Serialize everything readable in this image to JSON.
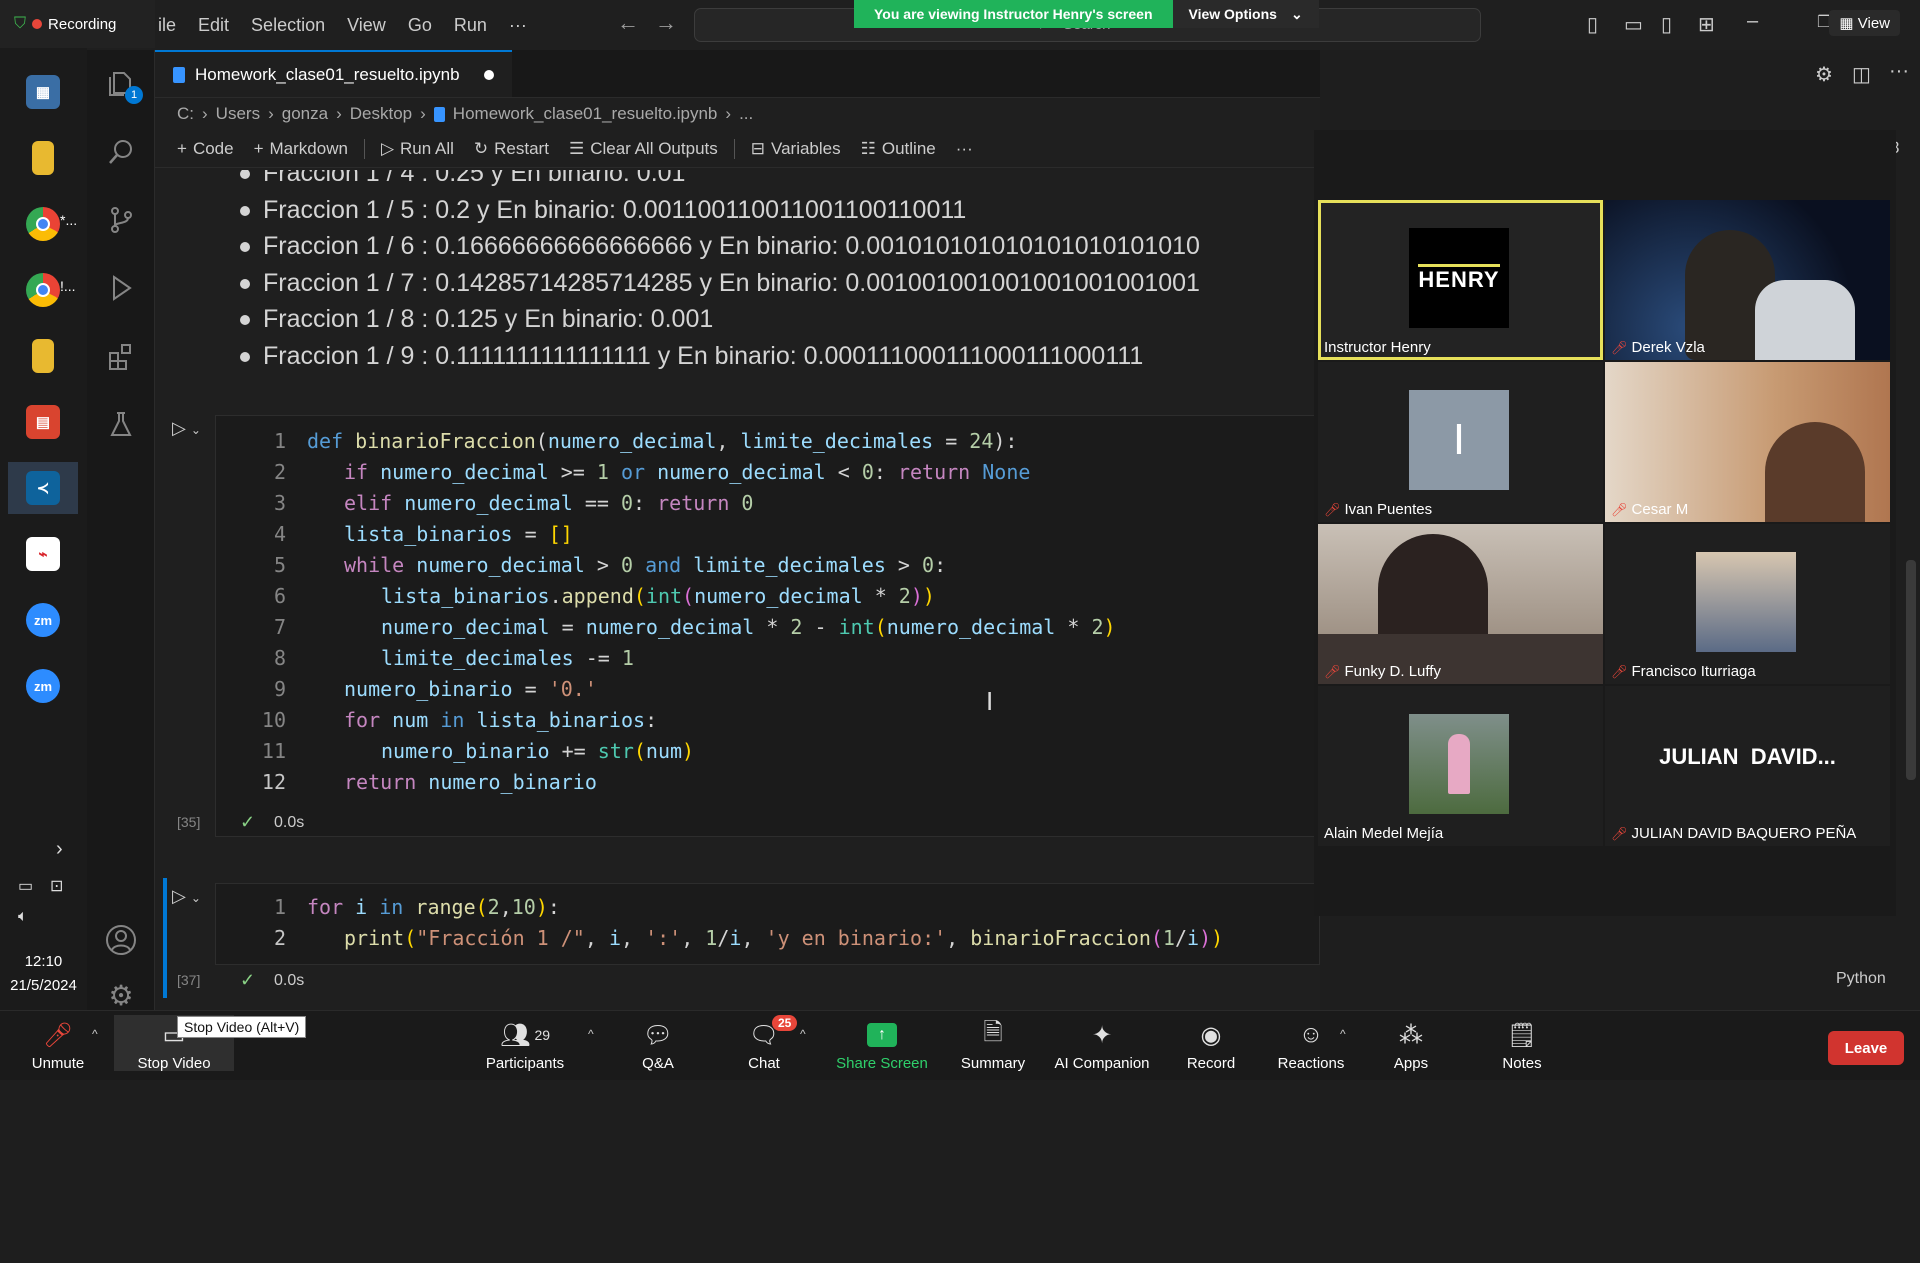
{
  "taskbar": {
    "recording_label": "Recording",
    "apps": [
      {
        "name": "calculator",
        "label": ""
      },
      {
        "name": "file-explorer",
        "label": ""
      },
      {
        "name": "chrome-1",
        "label": "*..."
      },
      {
        "name": "chrome-2",
        "label": "!..."
      },
      {
        "name": "file-explorer-2",
        "label": ""
      },
      {
        "name": "app-red",
        "label": ""
      },
      {
        "name": "vscode",
        "label": ""
      },
      {
        "name": "acrobat",
        "label": ""
      },
      {
        "name": "zoom-1",
        "label": "zm"
      },
      {
        "name": "zoom-2",
        "label": "zm"
      }
    ],
    "time": "12:10",
    "date": "21/5/2024"
  },
  "titlebar": {
    "menu": [
      "ile",
      "Edit",
      "Selection",
      "View",
      "Go",
      "Run",
      "···"
    ],
    "search_placeholder": "Search"
  },
  "share_banner": {
    "message": "You are viewing Instructor Henry's screen",
    "options": "View Options"
  },
  "view_button": "View",
  "editor": {
    "tab_title": "Homework_clase01_resuelto.ipynb",
    "breadcrumb": [
      "C:",
      "Users",
      "gonza",
      "Desktop",
      "Homework_clase01_resuelto.ipynb",
      "..."
    ],
    "toolbar": {
      "code": "Code",
      "markdown": "Markdown",
      "run_all": "Run All",
      "restart": "Restart",
      "clear_all": "Clear All Outputs",
      "variables": "Variables",
      "outline": "Outline",
      "more": "···"
    },
    "output_lines": [
      "Fraccion 1 / 4 : 0.25 y En binario: 0.01",
      "Fraccion 1 / 5 : 0.2 y En binario: 0.001100110011001100110011",
      "Fraccion 1 / 6 : 0.16666666666666666 y En binario: 0.001010101010101010101010",
      "Fraccion 1 / 7 : 0.14285714285714285 y En binario: 0.001001001001001001001001",
      "Fraccion 1 / 8 : 0.125 y En binario: 0.001",
      "Fraccion 1 / 9 : 0.1111111111111111 y En binario: 0.000111000111000111000111"
    ],
    "cell1": {
      "exec_count": "[35]",
      "exec_time": "0.0s",
      "line_numbers": [
        "1",
        "2",
        "3",
        "4",
        "5",
        "6",
        "7",
        "8",
        "9",
        "10",
        "11",
        "12"
      ]
    },
    "cell2": {
      "exec_count": "[37]",
      "exec_time": "0.0s",
      "line_numbers": [
        "1",
        "2"
      ]
    },
    "language": "Python"
  },
  "gallery": {
    "page": "8",
    "participants": [
      {
        "name": "Instructor Henry",
        "muted": false,
        "avatar": "HENRY"
      },
      {
        "name": "Derek Vzla",
        "muted": true,
        "avatar": ""
      },
      {
        "name": "Ivan Puentes",
        "muted": true,
        "avatar": "I"
      },
      {
        "name": "Cesar M",
        "muted": true,
        "avatar": ""
      },
      {
        "name": "Funky D. Luffy",
        "muted": true,
        "avatar": ""
      },
      {
        "name": "Francisco Iturriaga",
        "muted": true,
        "avatar": ""
      },
      {
        "name": "Alain Medel Mejía",
        "muted": false,
        "avatar": ""
      },
      {
        "name": "JULIAN DAVID BAQUERO PEÑA",
        "muted": true,
        "avatar": "JULIAN  DAVID..."
      }
    ]
  },
  "zoom_toolbar": {
    "unmute": "Unmute",
    "stop_video": "Stop Video",
    "tooltip": "Stop Video (Alt+V)",
    "participants": "Participants",
    "participants_count": "29",
    "qa": "Q&A",
    "chat": "Chat",
    "chat_badge": "25",
    "share_screen": "Share Screen",
    "summary": "Summary",
    "ai_companion": "AI Companion",
    "record": "Record",
    "reactions": "Reactions",
    "apps": "Apps",
    "notes": "Notes",
    "leave": "Leave"
  },
  "colors": {
    "accent": "#0078d4",
    "share_green": "#20b35a",
    "leave_red": "#d1342f",
    "active_speaker": "#e6e05a"
  }
}
